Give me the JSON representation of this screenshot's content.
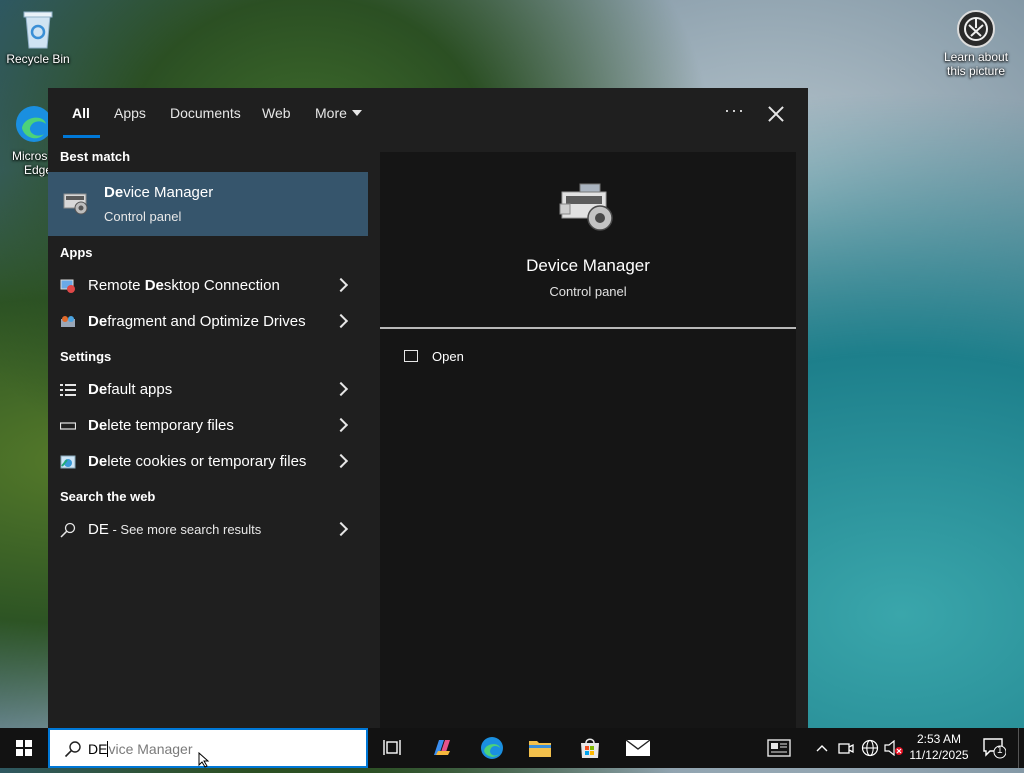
{
  "desktop": {
    "recycle_bin_label": "Recycle Bin",
    "edge_label_line1": "Micros",
    "edge_label_line2": "Edge",
    "learn_label_line1": "Learn about",
    "learn_label_line2": "this picture"
  },
  "search_panel": {
    "tabs": [
      {
        "label": "All",
        "active": true
      },
      {
        "label": "Apps"
      },
      {
        "label": "Documents"
      },
      {
        "label": "Web"
      },
      {
        "label": "More"
      }
    ],
    "best_match": {
      "heading": "Best match",
      "title_bold": "De",
      "title_rest": "vice Manager",
      "subtitle": "Control panel"
    },
    "apps": {
      "heading": "Apps",
      "items": [
        {
          "pre": "Remote ",
          "bold": "De",
          "post": "sktop Connection"
        },
        {
          "pre": "",
          "bold": "De",
          "post": "fragment and Optimize Drives"
        }
      ]
    },
    "settings": {
      "heading": "Settings",
      "items": [
        {
          "pre": "",
          "bold": "De",
          "post": "fault apps"
        },
        {
          "pre": "",
          "bold": "De",
          "post": "lete temporary files"
        },
        {
          "pre": "",
          "bold": "De",
          "post": "lete cookies or temporary files"
        }
      ]
    },
    "web": {
      "heading": "Search the web",
      "query": "DE",
      "suffix": " - See more search results"
    },
    "preview": {
      "title": "Device Manager",
      "subtitle": "Control panel",
      "actions": [
        {
          "label": "Open"
        }
      ]
    }
  },
  "taskbar": {
    "search_typed": "DE",
    "search_placeholder_rest": "vice Manager",
    "time": "2:53 AM",
    "date": "11/12/2025",
    "notification_count": "1"
  },
  "colors": {
    "accent": "#0078d7",
    "selected_row": "#36556c",
    "panel_bg": "#1f1f1f",
    "preview_bg": "#151515"
  }
}
